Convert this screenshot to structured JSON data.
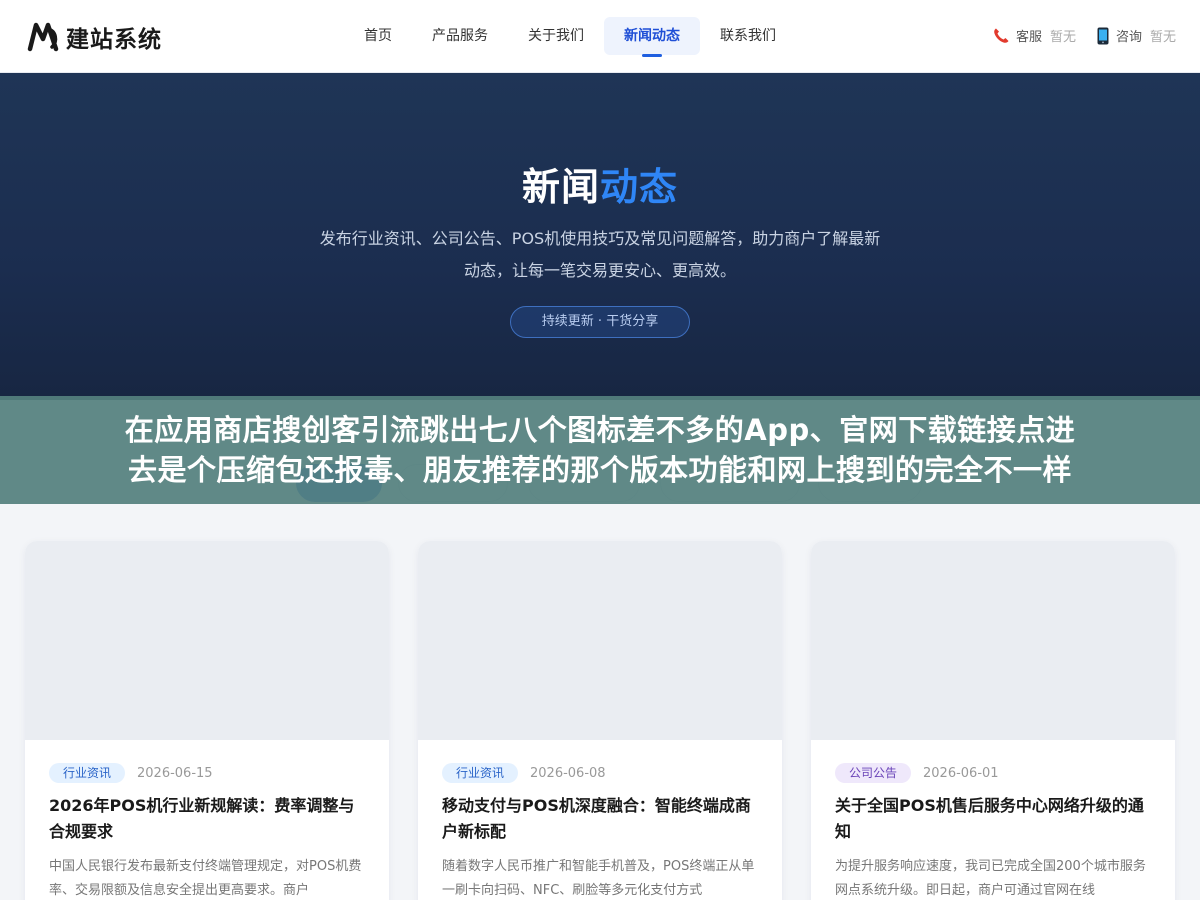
{
  "header": {
    "logo_text": "建站系统",
    "nav": [
      "首页",
      "产品服务",
      "关于我们",
      "新闻动态",
      "联系我们"
    ],
    "active_nav": "新闻动态",
    "contacts": [
      {
        "icon": "phone-icon",
        "label": "客服",
        "value": "暂无"
      },
      {
        "icon": "mobile-icon",
        "label": "咨询",
        "value": "暂无"
      }
    ]
  },
  "hero": {
    "title_main": "新闻",
    "title_accent": "动态",
    "desc_line1": "发布行业资讯、公司公告、POS机使用技巧及常见问题解答，助力商户了解最新",
    "desc_line2": "动态，让每一笔交易更安心、更高效。",
    "pill": "持续更新 · 干货分享"
  },
  "overlay": {
    "line1": "在应用商店搜创客引流跳出七八个图标差不多的App、官网下载链接点进",
    "line2": "去是个压缩包还报毒、朋友推荐的那个版本功能和网上搜到的完全不一样"
  },
  "cards": [
    {
      "tag": "行业资讯",
      "date": "2026-06-15",
      "title": "2026年POS机行业新规解读：费率调整与合规要求",
      "desc": "中国人民银行发布最新支付终端管理规定，对POS机费率、交易限额及信息安全提出更高要求。商户"
    },
    {
      "tag": "行业资讯",
      "date": "2026-06-08",
      "title": "移动支付与POS机深度融合：智能终端成商户新标配",
      "desc": "随着数字人民币推广和智能手机普及，POS终端正从单一刷卡向扫码、NFC、刷脸等多元化支付方式"
    },
    {
      "tag": "公司公告",
      "date": "2026-06-01",
      "title": "关于全国POS机售后服务中心网络升级的通知",
      "desc": "为提升服务响应速度，我司已完成全国200个城市服务网点系统升级。即日起，商户可通过官网在线"
    }
  ]
}
